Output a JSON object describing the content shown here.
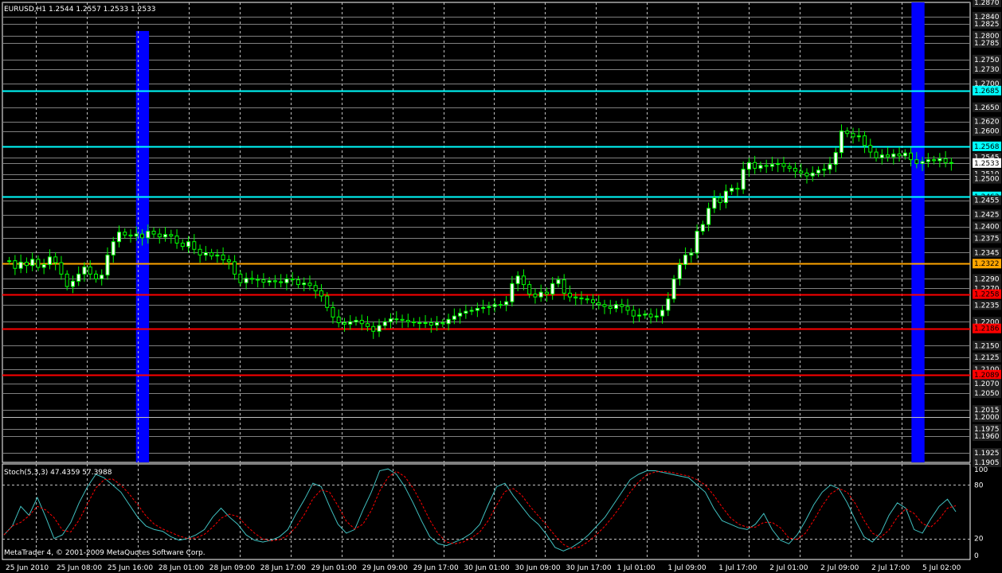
{
  "window": {
    "symbol_line": "EURUSD,H1  1.2544 1.2557 1.2533 1.2533",
    "indicator_line": "Stoch(5,3,3) 47.4359 57.3988",
    "copyright": "MetaTrader 4, © 2001-2009 MetaQuotes Software Corp."
  },
  "colors": {
    "background": "#000000",
    "grid": "#c0c0c0",
    "candle_bull": "#ffffff",
    "candle_bear": "#00ff00",
    "wick": "#00ff00",
    "session_band": "#0000ff",
    "level_cyan": "#00ffff",
    "level_orange": "#ffa500",
    "level_red": "#ff0000",
    "stoch_main": "#40c0c0",
    "stoch_signal": "#ff0000"
  },
  "chart_data": {
    "type": "candlestick",
    "price_axis": {
      "range": [
        1.1905,
        1.287
      ],
      "ticks": [
        "1.2870",
        "1.2840",
        "1.2825",
        "1.2800",
        "1.2785",
        "1.2750",
        "1.2730",
        "1.2700",
        "1.2685",
        "1.2650",
        "1.2620",
        "1.2600",
        "1.2568",
        "1.2545",
        "1.2533",
        "1.2510",
        "1.2500",
        "1.2463",
        "1.2455",
        "1.2425",
        "1.2400",
        "1.2375",
        "1.2345",
        "1.2322",
        "1.2290",
        "1.2270",
        "1.2258",
        "1.2235",
        "1.2200",
        "1.2186",
        "1.2150",
        "1.2125",
        "1.2100",
        "1.2089",
        "1.2070",
        "1.2050",
        "1.2015",
        "1.2000",
        "1.1975",
        "1.1960",
        "1.1925",
        "1.1905"
      ]
    },
    "time_axis": {
      "labels": [
        "25 Jun 2010",
        "25 Jun 08:00",
        "25 Jun 16:00",
        "28 Jun 01:00",
        "28 Jun 09:00",
        "28 Jun 17:00",
        "29 Jun 01:00",
        "29 Jun 09:00",
        "29 Jun 17:00",
        "30 Jun 01:00",
        "30 Jun 09:00",
        "30 Jun 17:00",
        "1 Jul 01:00",
        "1 Jul 09:00",
        "1 Jul 17:00",
        "2 Jul 01:00",
        "2 Jul 09:00",
        "2 Jul 17:00",
        "5 Jul 02:00"
      ]
    },
    "current_price": "1.2533",
    "levels": [
      {
        "price": 1.2685,
        "label": "1.2685",
        "color": "cyan"
      },
      {
        "price": 1.2568,
        "label": "1.2568",
        "color": "cyan"
      },
      {
        "price": 1.2463,
        "label": "1.2463",
        "color": "cyan"
      },
      {
        "price": 1.2322,
        "label": "1.2322",
        "color": "orange"
      },
      {
        "price": 1.2258,
        "label": "1.2258",
        "color": "red"
      },
      {
        "price": 1.2186,
        "label": "1.2186",
        "color": "red"
      },
      {
        "price": 1.2089,
        "label": "1.2089",
        "color": "red"
      },
      {
        "price": 1.2,
        "label": "",
        "color": "grey"
      }
    ],
    "session_bands": [
      {
        "from_bar": 41,
        "to_bar": 44,
        "top_price": 1.281
      },
      {
        "from_bar": 279,
        "to_bar": 282,
        "top_price": 1.287
      }
    ],
    "closes": [
      1.2328,
      1.2312,
      1.2325,
      1.2318,
      1.2331,
      1.2314,
      1.232,
      1.2336,
      1.2324,
      1.23,
      1.2274,
      1.2285,
      1.23,
      1.2315,
      1.23,
      1.229,
      1.2298,
      1.234,
      1.2368,
      1.2388,
      1.2382,
      1.238,
      1.2384,
      1.2376,
      1.239,
      1.2384,
      1.2378,
      1.2383,
      1.238,
      1.2365,
      1.2358,
      1.2368,
      1.2352,
      1.234,
      1.2345,
      1.2338,
      1.234,
      1.233,
      1.2326,
      1.23,
      1.2282,
      1.2291,
      1.2289,
      1.2288,
      1.2283,
      1.2286,
      1.2284,
      1.2282,
      1.229,
      1.2288,
      1.2278,
      1.2281,
      1.2276,
      1.2265,
      1.2254,
      1.223,
      1.221,
      1.2198,
      1.2195,
      1.22,
      1.2203,
      1.2196,
      1.219,
      1.218,
      1.2192,
      1.22,
      1.2206,
      1.2205,
      1.2203,
      1.22,
      1.2198,
      1.2197,
      1.2198,
      1.2193,
      1.2198,
      1.2196,
      1.2205,
      1.2212,
      1.2218,
      1.2222,
      1.2224,
      1.2228,
      1.223,
      1.2232,
      1.2236,
      1.2236,
      1.2242,
      1.228,
      1.2296,
      1.2278,
      1.2258,
      1.2252,
      1.2262,
      1.2258,
      1.228,
      1.2288,
      1.226,
      1.2252,
      1.225,
      1.2248,
      1.2246,
      1.224,
      1.2236,
      1.2232,
      1.2228,
      1.2236,
      1.2232,
      1.2224,
      1.2212,
      1.2214,
      1.2216,
      1.221,
      1.2212,
      1.2224,
      1.2248,
      1.229,
      1.232,
      1.234,
      1.2344,
      1.239,
      1.2404,
      1.2438,
      1.246,
      1.245,
      1.2474,
      1.248,
      1.2478,
      1.252,
      1.2534,
      1.2522,
      1.2528,
      1.2526,
      1.253,
      1.2532,
      1.2526,
      1.2522,
      1.2516,
      1.2512,
      1.2506,
      1.2512,
      1.2518,
      1.252,
      1.253,
      1.2555,
      1.26,
      1.2595,
      1.2588,
      1.259,
      1.257,
      1.2556,
      1.2544,
      1.255,
      1.2546,
      1.2552,
      1.2548,
      1.2554,
      1.254,
      1.2532,
      1.2536,
      1.254,
      1.2538,
      1.2542,
      1.2534,
      1.2533
    ],
    "stochastic": {
      "name": "Stoch(5,3,3)",
      "main": 47.4359,
      "signal": 57.3988,
      "levels": [
        80,
        20
      ],
      "axis_ticks": [
        "100",
        "80",
        "20",
        "0"
      ],
      "main_series": [
        24,
        34,
        56,
        46,
        66,
        44,
        20,
        24,
        38,
        60,
        78,
        92,
        88,
        80,
        72,
        58,
        44,
        34,
        30,
        28,
        22,
        18,
        20,
        24,
        30,
        44,
        54,
        44,
        36,
        24,
        18,
        16,
        18,
        22,
        30,
        48,
        64,
        82,
        78,
        56,
        36,
        26,
        30,
        52,
        72,
        96,
        98,
        92,
        78,
        60,
        40,
        22,
        14,
        12,
        16,
        20,
        26,
        36,
        58,
        78,
        82,
        68,
        56,
        44,
        36,
        24,
        10,
        6,
        10,
        16,
        24,
        34,
        44,
        58,
        72,
        86,
        92,
        96,
        96,
        94,
        92,
        90,
        88,
        80,
        72,
        54,
        40,
        36,
        32,
        30,
        36,
        48,
        30,
        18,
        14,
        24,
        40,
        58,
        72,
        80,
        76,
        60,
        40,
        22,
        16,
        26,
        46,
        60,
        54,
        30,
        26,
        42,
        56,
        64,
        50
      ]
    }
  }
}
